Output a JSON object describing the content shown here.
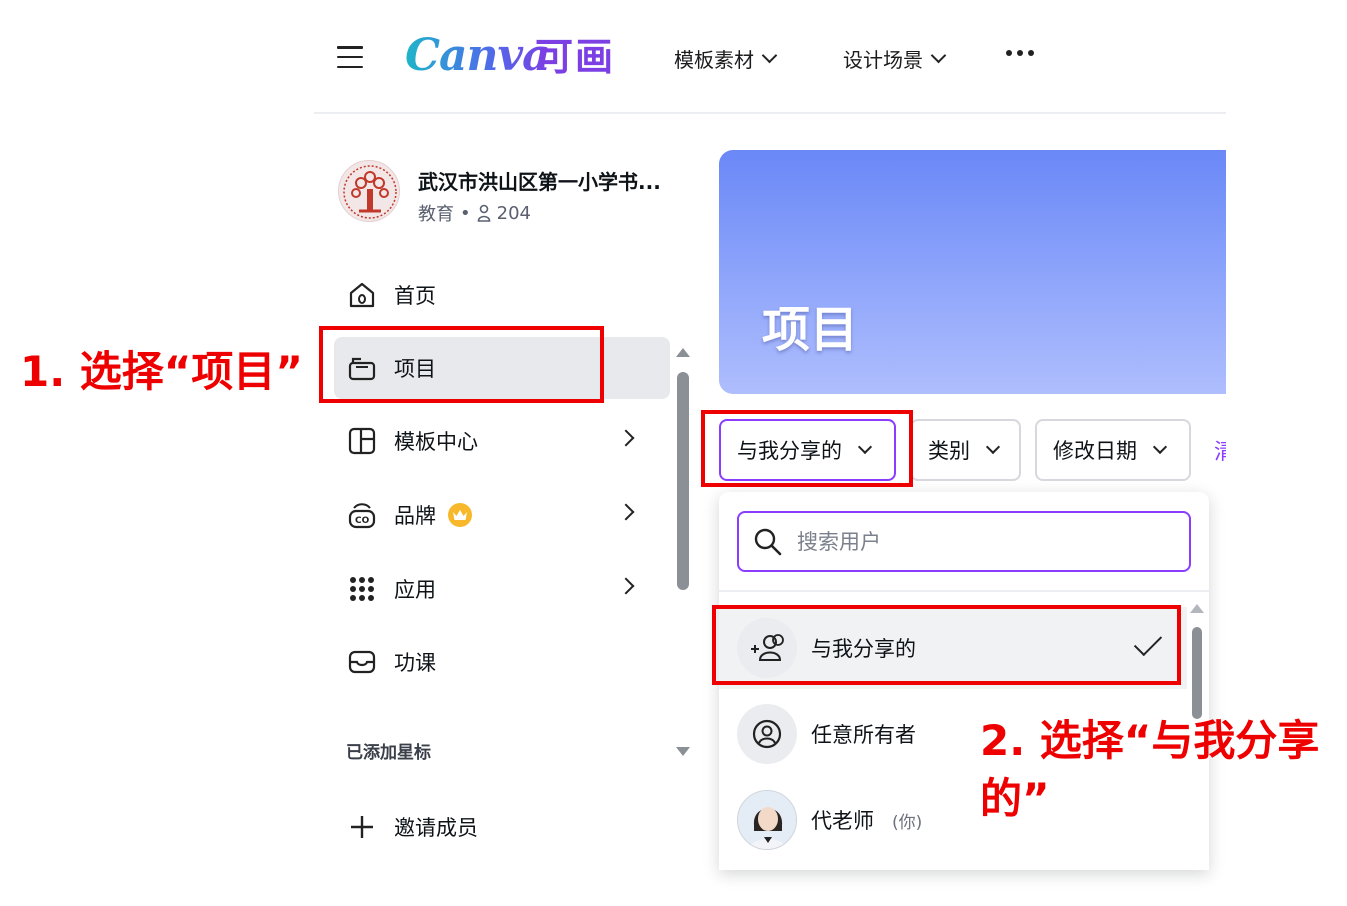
{
  "header": {
    "logo_text": "Canva",
    "logo_cn": "可画",
    "nav": [
      {
        "label": "模板素材"
      },
      {
        "label": "设计场景"
      }
    ]
  },
  "team": {
    "name": "武汉市洪山区第一小学书...",
    "category": "教育",
    "separator": "•",
    "member_count": "204"
  },
  "sidebar": {
    "items": [
      {
        "label": "首页"
      },
      {
        "label": "项目"
      },
      {
        "label": "模板中心"
      },
      {
        "label": "品牌"
      },
      {
        "label": "应用"
      },
      {
        "label": "功课"
      }
    ],
    "starred_label": "已添加星标",
    "invite_label": "邀请成员"
  },
  "main": {
    "title": "项目",
    "filters": [
      {
        "label": "与我分享的"
      },
      {
        "label": "类别"
      },
      {
        "label": "修改日期"
      }
    ],
    "partial_text": "清"
  },
  "dropdown": {
    "search_placeholder": "搜索用户",
    "options": [
      {
        "label": "与我分享的",
        "selected": true
      },
      {
        "label": "任意所有者"
      },
      {
        "label": "代老师",
        "suffix": "(你)"
      }
    ]
  },
  "annotations": {
    "step1": "1. 选择“项目”",
    "step2": "2. 选择“与我分享的”"
  },
  "colors": {
    "accent": "#8b3dff",
    "annotation_red": "#ee0000",
    "hero_blue": "#6a88f7"
  }
}
